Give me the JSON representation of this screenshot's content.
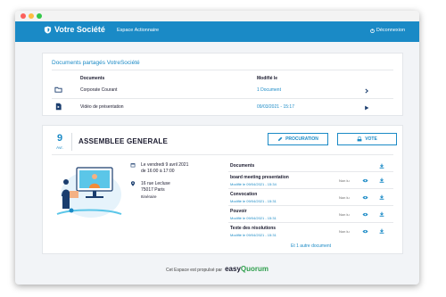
{
  "appbar": {
    "brand": "Votre Société",
    "nav": "Espace Actionnaire",
    "logout": "Déconnexion",
    "color": "#1a8ac6"
  },
  "shared": {
    "title": "Documents partagés VotreSociété",
    "col_documents": "Documents",
    "col_modified": "Modifié le",
    "rows": [
      {
        "icon": "folder-icon",
        "name": "Corporate Courant",
        "modified": "1 Document",
        "action": "chevron-right-icon"
      },
      {
        "icon": "file-video-icon",
        "name": "Vidéo de présentation",
        "modified": "09/03/2021 - 15:17",
        "action": "play-icon"
      }
    ]
  },
  "meeting": {
    "day": "9",
    "month": "Avr.",
    "title": "ASSEMBLEE GENERALE",
    "proxy_label": "PROCURATION",
    "vote_label": "VOTE",
    "date_line1": "Le vendredi 9 avril 2021",
    "date_line2": "de 16:00 à 17:00",
    "address_line1": "16 rue Lecluse",
    "address_line2": "75017 Paris",
    "itinerary": "Itinéraire",
    "docs_title": "Documents",
    "docs": [
      {
        "name": "board meeting presentation",
        "modified": "Modifié le 09/04/2021 - 15:34",
        "status": "Non lu"
      },
      {
        "name": "Convocation",
        "modified": "Modifié le 09/04/2021 - 15:31",
        "status": "Non lu"
      },
      {
        "name": "Pouvoir",
        "modified": "Modifié le 09/04/2021 - 15:31",
        "status": "Non lu"
      },
      {
        "name": "Texte des résolutions",
        "modified": "Modifié le 09/04/2021 - 15:31",
        "status": "Non lu"
      }
    ],
    "more_docs": "Et 1 autre document"
  },
  "footer": {
    "text": "Cet Espace est propulsé par",
    "brand_part1": "easy",
    "brand_part2": "Quorum"
  }
}
